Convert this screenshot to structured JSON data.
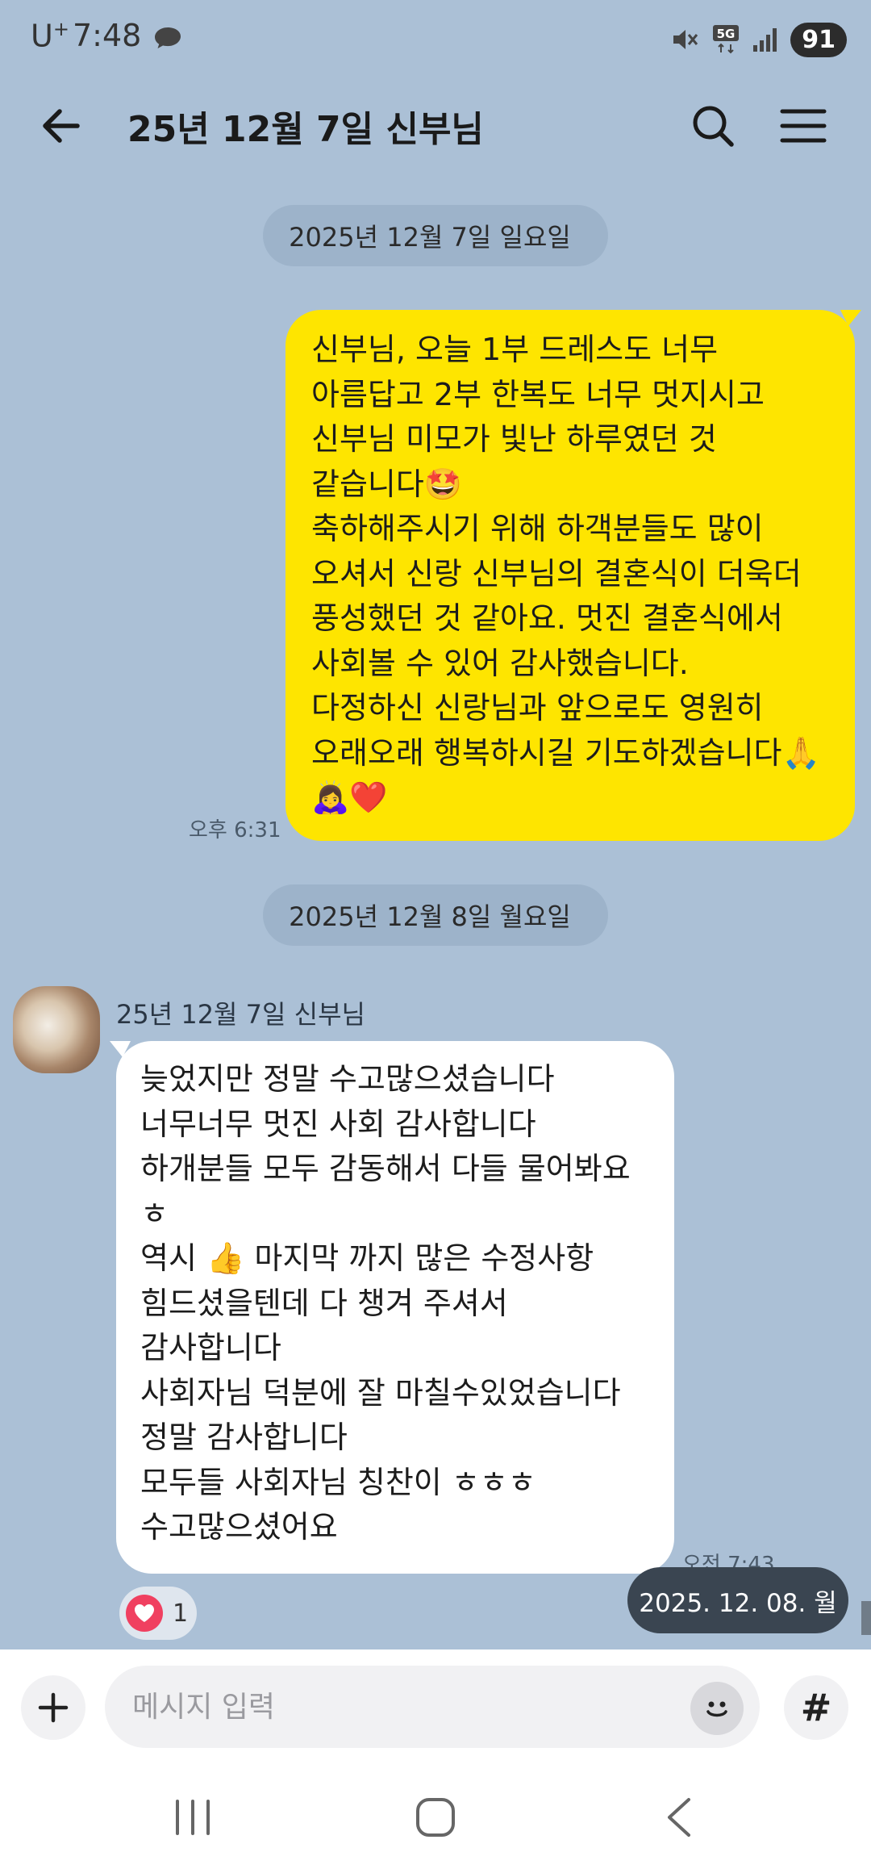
{
  "status_bar": {
    "carrier": "U",
    "carrier_sup": "+",
    "time": "7:48",
    "network": "5G",
    "battery": "91"
  },
  "header": {
    "title": "25년 12월 7일 신부님"
  },
  "date_dividers": [
    {
      "label": "2025년 12월 7일 일요일"
    },
    {
      "label": "2025년 12월 8일 월요일"
    }
  ],
  "sent_message": {
    "lines": [
      "신부님, 오늘 1부 드레스도 너무",
      "아름답고 2부 한복도 너무 멋지시고",
      "신부님 미모가 빛난 하루였던 것",
      "같습니다🤩",
      "축하해주시기 위해 하객분들도 많이",
      "오셔서 신랑 신부님의 결혼식이 더욱더",
      "풍성했던 것 같아요. 멋진 결혼식에서",
      "사회볼 수 있어 감사했습니다.",
      "다정하신 신랑님과 앞으로도 영원히",
      "오래오래 행복하시길 기도하겠습니다🙏",
      "🙇‍♀️❤️"
    ],
    "time": "오후 6:31"
  },
  "received_message": {
    "sender": "25년 12월 7일 신부님",
    "lines": [
      "늦었지만 정말 수고많으셨습니다",
      "너무너무 멋진 사회 감사합니다",
      "하개분들 모두 감동해서 다들 물어봐요",
      "ㅎ",
      "역시 👍  마지막 까지 많은 수정사항",
      "힘드셨을텐데 다 챙겨 주셔서",
      "감사합니다",
      "사회자님 덕분에 잘 마칠수있었습니다",
      "정말 감사합니다",
      "모두들 사회자님 칭찬이 ㅎㅎㅎ",
      "수고많으셨어요"
    ],
    "time": "오전 7:43",
    "reaction_count": "1"
  },
  "date_toast": "2025. 12. 08. 월",
  "input": {
    "placeholder": "메시지 입력",
    "hash_label": "#"
  },
  "colors": {
    "chat_background": "#abc0d6",
    "sent_bubble": "#fee500",
    "received_bubble": "#ffffff",
    "reaction_heart": "#f04060"
  }
}
